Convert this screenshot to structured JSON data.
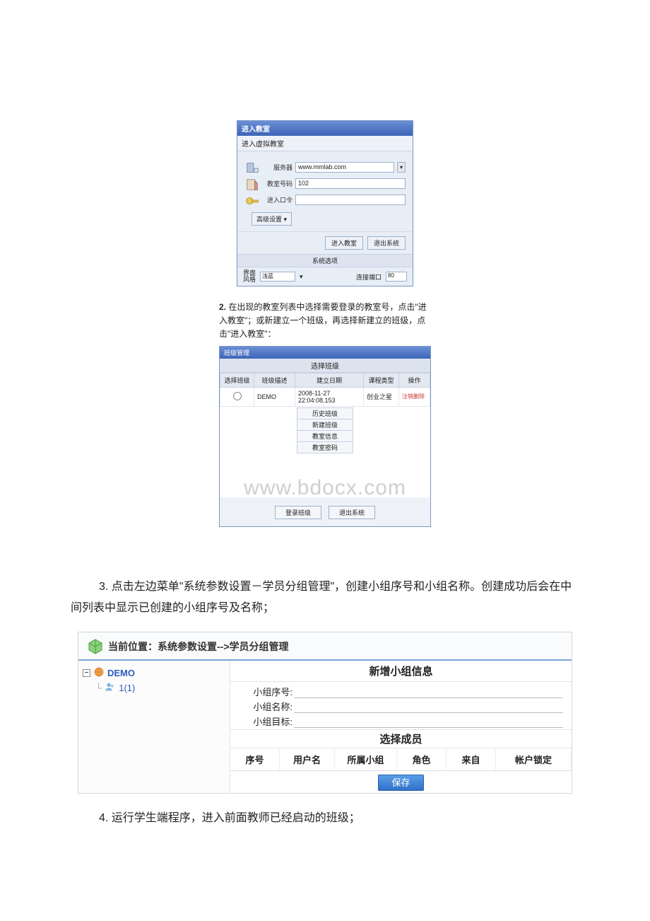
{
  "dlg1": {
    "title": "进入教室",
    "subtitle": "进入虚拟教室",
    "server_label": "服务器",
    "server_value": "www.mmlab.com",
    "room_label": "教室号码",
    "room_value": "102",
    "pass_label": "进入口令",
    "adv_label": "高级设置",
    "enter_btn": "进入教室",
    "exit_btn": "退出系统",
    "sysbar": "系统选项",
    "ui_label": "界面\n风格",
    "ui_value": "浅蓝",
    "port_label": "连接端口",
    "port_value": "80"
  },
  "step2": {
    "num": "2.",
    "text": " 在出现的教室列表中选择需要登录的教室号，点击\"进入教室\"；或新建立一个班级，再选择新建立的班级，点击\"进入教室\"："
  },
  "dlg2": {
    "title": "班级管理",
    "header": "选择班级",
    "cols": {
      "c1": "选择班级",
      "c2": "班级描述",
      "c3": "建立日期",
      "c4": "课程类型",
      "c5": "操作"
    },
    "row": {
      "desc": "DEMO",
      "date": "2008-11-27 22:04:08.153",
      "type": "创业之星",
      "op": "注销删除"
    },
    "tabs": [
      "历史班级",
      "新建班级",
      "教室信息",
      "教室密码"
    ],
    "btn_login": "登录班级",
    "btn_exit": "退出系统"
  },
  "watermark": "www.bdocx.com",
  "para3": "3. 点击左边菜单\"系统参数设置－学员分组管理\"，创建小组序号和小组名称。创建成功后会在中间列表中显示已创建的小组序号及名称；",
  "gm": {
    "breadcrumb": "当前位置：系统参数设置-->学员分组管理",
    "tree_root": "DEMO",
    "tree_child": "1(1)",
    "sect1": "新增小组信息",
    "f1": "小组序号:",
    "f2": "小组名称:",
    "f3": "小组目标:",
    "sect2": "选择成员",
    "th": {
      "c1": "序号",
      "c2": "用户名",
      "c3": "所属小组",
      "c4": "角色",
      "c5": "来自",
      "c6": "帐户锁定"
    },
    "save": "保存"
  },
  "para4": "4. 运行学生端程序，进入前面教师已经启动的班级；"
}
